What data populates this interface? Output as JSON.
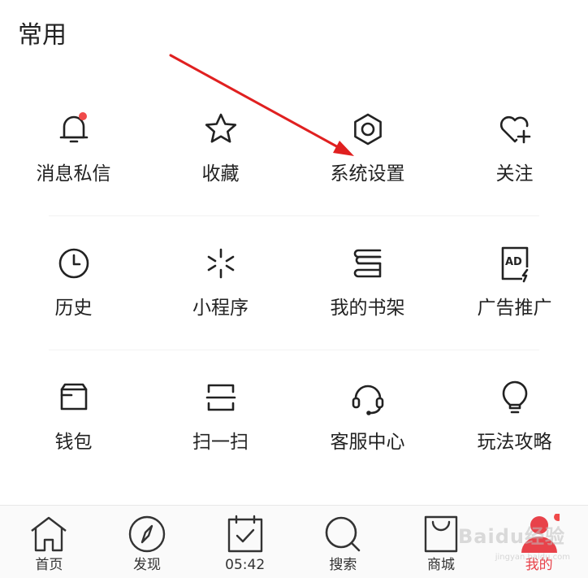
{
  "section": {
    "title": "常用"
  },
  "grid": [
    [
      {
        "label": "消息私信",
        "icon": "bell-icon",
        "badge": true
      },
      {
        "label": "收藏",
        "icon": "star-icon"
      },
      {
        "label": "系统设置",
        "icon": "gear-icon"
      },
      {
        "label": "关注",
        "icon": "heart-plus-icon"
      }
    ],
    [
      {
        "label": "历史",
        "icon": "clock-icon"
      },
      {
        "label": "小程序",
        "icon": "mini-program-icon"
      },
      {
        "label": "我的书架",
        "icon": "bookshelf-icon"
      },
      {
        "label": "广告推广",
        "icon": "ad-icon",
        "icon_text": "AD"
      }
    ],
    [
      {
        "label": "钱包",
        "icon": "wallet-icon"
      },
      {
        "label": "扫一扫",
        "icon": "scan-icon"
      },
      {
        "label": "客服中心",
        "icon": "headset-icon"
      },
      {
        "label": "玩法攻略",
        "icon": "lightbulb-icon"
      }
    ]
  ],
  "bottom_nav": [
    {
      "label": "首页",
      "icon": "home-icon"
    },
    {
      "label": "发现",
      "icon": "compass-icon"
    },
    {
      "label": "05:42",
      "icon": "calendar-check-icon"
    },
    {
      "label": "搜索",
      "icon": "search-icon"
    },
    {
      "label": "商城",
      "icon": "shopping-bag-icon"
    },
    {
      "label": "我的",
      "icon": "user-icon",
      "active": true,
      "badge": true
    }
  ],
  "watermark": {
    "text": "Baidu经验",
    "subtext": "jingyan.baidu.com"
  },
  "colors": {
    "accent": "#e8424a",
    "badge": "#f04a4a",
    "text": "#222222",
    "arrow": "#e02020"
  }
}
